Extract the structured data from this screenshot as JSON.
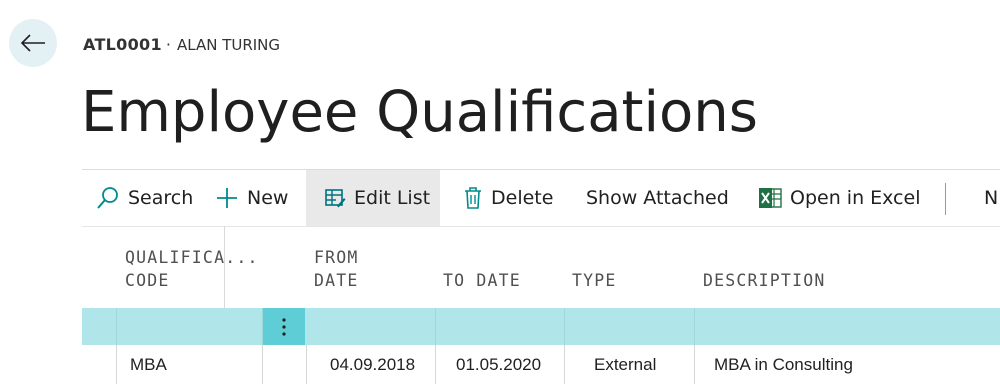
{
  "header": {
    "record_code": "ATL0001",
    "separator": "·",
    "employee_name": "ALAN TURING",
    "page_title": "Employee Qualifications"
  },
  "toolbar": {
    "search": "Search",
    "new": "New",
    "edit_list": "Edit List",
    "delete": "Delete",
    "show_attached": "Show Attached",
    "open_in_excel": "Open in Excel",
    "overflow": "N"
  },
  "columns": {
    "qualification_code": [
      "QUALIFICA...",
      "CODE"
    ],
    "from_date": [
      "FROM",
      "DATE"
    ],
    "to_date": "TO DATE",
    "type": "TYPE",
    "description": "DESCRIPTION"
  },
  "rows": [
    {
      "qualification_code": "MBA",
      "from_date": "04.09.2018",
      "to_date": "01.05.2020",
      "type": "External",
      "description": "MBA in Consulting"
    }
  ],
  "colors": {
    "accent": "#00a4b4",
    "selected_row": "#b0e6ea",
    "more_button": "#5ecdd5",
    "back_button_bg": "#e3f1f4"
  }
}
